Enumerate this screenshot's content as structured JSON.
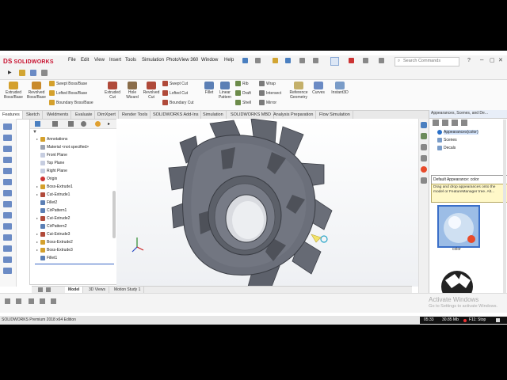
{
  "app": {
    "logo": "SOLIDWORKS",
    "logo_mark": "DS",
    "menus": [
      "File",
      "Edit",
      "View",
      "Insert",
      "Tools",
      "Simulation",
      "PhotoView 360",
      "Window",
      "Help"
    ],
    "search_placeholder": "Search Commands"
  },
  "command_manager": {
    "large_tools": [
      {
        "label": "Extruded Boss/Base",
        "icon": "extruded-boss-icon"
      },
      {
        "label": "Revolved Boss/Base",
        "icon": "revolved-boss-icon"
      },
      {
        "label": "Extruded Cut",
        "icon": "extruded-cut-icon"
      },
      {
        "label": "Hole Wizard",
        "icon": "hole-wizard-icon"
      },
      {
        "label": "Revolved Cut",
        "icon": "revolved-cut-icon"
      },
      {
        "label": "Fillet",
        "icon": "fillet-icon"
      },
      {
        "label": "Linear Pattern",
        "icon": "linear-pattern-icon"
      },
      {
        "label": "Reference Geometry",
        "icon": "reference-geometry-icon"
      },
      {
        "label": "Curves",
        "icon": "curves-icon"
      },
      {
        "label": "Instant3D",
        "icon": "instant3d-icon"
      }
    ],
    "small_tools": [
      {
        "label": "Swept Boss/Base"
      },
      {
        "label": "Lofted Boss/Base"
      },
      {
        "label": "Boundary Boss/Base"
      },
      {
        "label": "Swept Cut"
      },
      {
        "label": "Lofted Cut"
      },
      {
        "label": "Boundary Cut"
      },
      {
        "label": "Rib"
      },
      {
        "label": "Draft"
      },
      {
        "label": "Shell"
      },
      {
        "label": "Wrap"
      },
      {
        "label": "Intersect"
      },
      {
        "label": "Mirror"
      }
    ]
  },
  "tabs": [
    "Features",
    "Sketch",
    "Weldments",
    "Evaluate",
    "DimXpert",
    "Render Tools",
    "SOLIDWORKS Add-Ins",
    "Simulation",
    "SOLIDWORKS MBD",
    "Analysis Preparation",
    "Flow Simulation"
  ],
  "feature_tree": [
    {
      "label": "Annotations",
      "expand": "▸"
    },
    {
      "label": "Material <not specified>",
      "expand": ""
    },
    {
      "label": "Front Plane",
      "expand": ""
    },
    {
      "label": "Top Plane",
      "expand": ""
    },
    {
      "label": "Right Plane",
      "expand": ""
    },
    {
      "label": "Origin",
      "expand": ""
    },
    {
      "label": "Boss-Extrude1",
      "expand": "▸"
    },
    {
      "label": "Cut-Extrude1",
      "expand": "▸"
    },
    {
      "label": "Fillet2",
      "expand": ""
    },
    {
      "label": "CirPattern1",
      "expand": ""
    },
    {
      "label": "Cut-Extrude2",
      "expand": "▸"
    },
    {
      "label": "CirPattern2",
      "expand": ""
    },
    {
      "label": "Cut-Extrude3",
      "expand": "▸"
    },
    {
      "label": "Boss-Extrude2",
      "expand": "▸"
    },
    {
      "label": "Boss-Extrude3",
      "expand": "▸"
    },
    {
      "label": "Fillet1",
      "expand": ""
    }
  ],
  "model_tabs": [
    "Model",
    "3D Views",
    "Motion Study 1"
  ],
  "task_pane": {
    "title": "Appearances, Scenes, and De...",
    "tree": [
      "Appearances(color)",
      "Scenes",
      "Decals"
    ],
    "tooltip_title": "Default Appearance: color",
    "tooltip_body": "Drag and drop appearances onto the model or FeatureManager tree. Alt...",
    "swatch_label": "color"
  },
  "status": {
    "app_edition": "SOLIDWORKS Premium 2018 x64 Edition",
    "recorder_time": "05:33",
    "recorder_size": "30.85 Mb",
    "recorder_hint": "F11: Stop"
  },
  "watermark": {
    "title": "Activate Windows",
    "body": "Go to Settings to activate Windows."
  },
  "colors": {
    "brand_red": "#c8102e",
    "part_gray": "#6b6f7a",
    "tooltip_bg": "#fff8c8",
    "viewport_bg": "#f8f8f8"
  }
}
